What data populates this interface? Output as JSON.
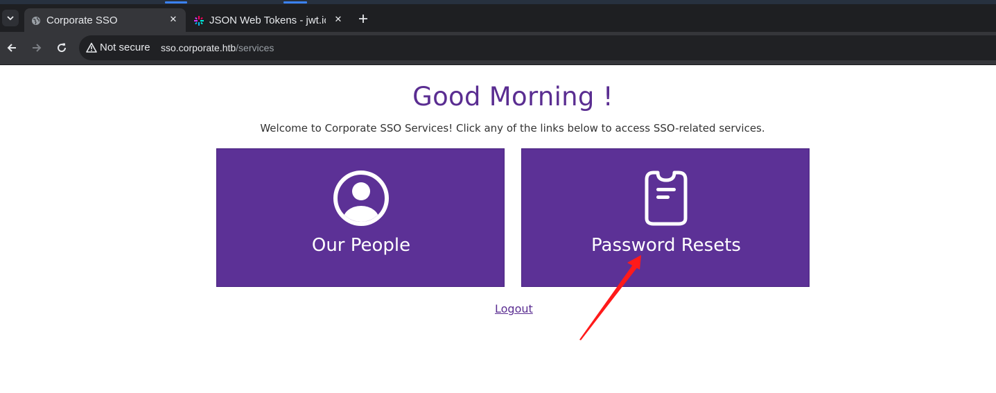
{
  "browser": {
    "tabs": [
      {
        "title": "Corporate SSO",
        "active": true,
        "favicon": "globe-icon"
      },
      {
        "title": "JSON Web Tokens - jwt.io",
        "active": false,
        "favicon": "jwt-logo-icon"
      }
    ],
    "security_label": "Not secure",
    "url_host": "sso.corporate.htb",
    "url_path": "/services"
  },
  "page": {
    "greeting": "Good Morning !",
    "welcome": "Welcome to Corporate SSO Services! Click any of the links below to access SSO-related services.",
    "cards": [
      {
        "label": "Our People",
        "icon": "user-circle-icon"
      },
      {
        "label": "Password Resets",
        "icon": "clipboard-icon"
      }
    ],
    "logout": "Logout"
  },
  "colors": {
    "brand_purple": "#5c3196",
    "heading_purple": "#5a2d91",
    "annotation_arrow": "#ff1a1a"
  }
}
